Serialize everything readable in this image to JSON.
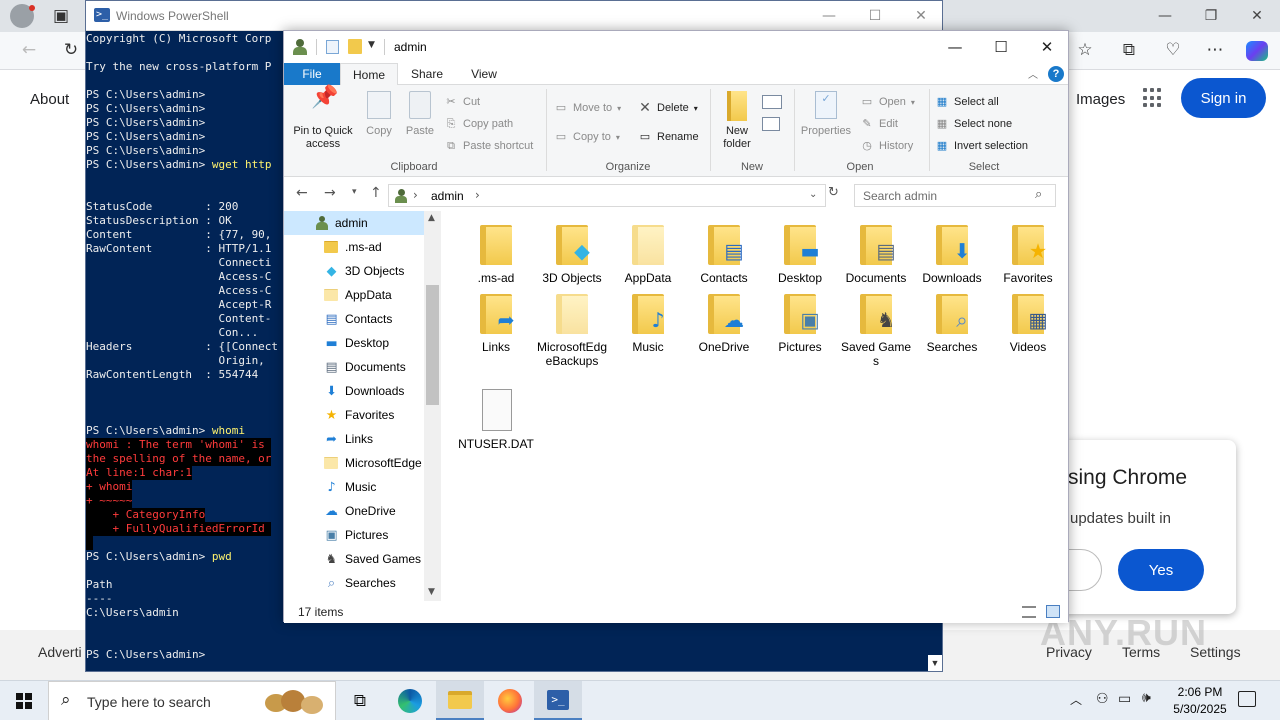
{
  "chrome": {
    "nav": {
      "about": "About",
      "images": "Images",
      "sign_in": "Sign in"
    },
    "promo": {
      "title": "sing Chrome",
      "subtitle": "updates built in",
      "yes": "Yes"
    },
    "footer": {
      "advertising": "Adverti",
      "privacy": "Privacy",
      "terms": "Terms",
      "settings": "Settings"
    },
    "watermark": "ANY.RUN"
  },
  "powershell": {
    "title": "Windows PowerShell",
    "lines": [
      {
        "t": "Copyright (C) Microsoft Corp"
      },
      {
        "t": ""
      },
      {
        "t": "Try the new cross-platform P"
      },
      {
        "t": ""
      },
      {
        "t": "PS C:\\Users\\admin>"
      },
      {
        "t": "PS C:\\Users\\admin>"
      },
      {
        "t": "PS C:\\Users\\admin>"
      },
      {
        "t": "PS C:\\Users\\admin>"
      },
      {
        "t": "PS C:\\Users\\admin>"
      },
      {
        "t": "PS C:\\Users\\admin> ",
        "cmd": "wget http"
      },
      {
        "t": ""
      },
      {
        "t": ""
      },
      {
        "t": "StatusCode        : 200"
      },
      {
        "t": "StatusDescription : OK"
      },
      {
        "t": "Content           : {77, 90,"
      },
      {
        "t": "RawContent        : HTTP/1.1"
      },
      {
        "t": "                    Connecti"
      },
      {
        "t": "                    Access-C"
      },
      {
        "t": "                    Access-C"
      },
      {
        "t": "                    Accept-R"
      },
      {
        "t": "                    Content-"
      },
      {
        "t": "                    Con..."
      },
      {
        "t": "Headers           : {[Connect"
      },
      {
        "t": "                    Origin, "
      },
      {
        "t": "RawContentLength  : 554744"
      },
      {
        "t": ""
      },
      {
        "t": ""
      },
      {
        "t": ""
      },
      {
        "t": "PS C:\\Users\\admin> ",
        "cmd": "whomi"
      },
      {
        "t": "whomi : The term 'whomi' is ",
        "err": true
      },
      {
        "t": "the spelling of the name, or",
        "err": true
      },
      {
        "t": "At line:1 char:1",
        "err": true
      },
      {
        "t": "+ whomi",
        "err": true
      },
      {
        "t": "+ ~~~~~",
        "err": true
      },
      {
        "t": "    + CategoryInfo",
        "err": true
      },
      {
        "t": "    + FullyQualifiedErrorId ",
        "err": true
      },
      {
        "t": " ",
        "err": true
      },
      {
        "t": "PS C:\\Users\\admin> ",
        "cmd": "pwd"
      },
      {
        "t": ""
      },
      {
        "t": "Path"
      },
      {
        "t": "----"
      },
      {
        "t": "C:\\Users\\admin"
      },
      {
        "t": ""
      },
      {
        "t": ""
      },
      {
        "t": "PS C:\\Users\\admin>"
      }
    ]
  },
  "explorer": {
    "title": "admin",
    "tabs": {
      "file": "File",
      "home": "Home",
      "share": "Share",
      "view": "View"
    },
    "ribbon": {
      "pin": "Pin to Quick access",
      "copy": "Copy",
      "paste": "Paste",
      "cut": "Cut",
      "copy_path": "Copy path",
      "paste_shortcut": "Paste shortcut",
      "clipboard": "Clipboard",
      "move_to": "Move to",
      "copy_to": "Copy to",
      "delete": "Delete",
      "rename": "Rename",
      "organize": "Organize",
      "new_folder": "New folder",
      "new": "New",
      "properties": "Properties",
      "open": "Open",
      "edit": "Edit",
      "history": "History",
      "open_group": "Open",
      "select_all": "Select all",
      "select_none": "Select none",
      "invert_selection": "Invert selection",
      "select": "Select"
    },
    "address": {
      "segment": "admin"
    },
    "search_placeholder": "Search admin",
    "tree": [
      {
        "label": "admin",
        "icon": "user",
        "selected": true
      },
      {
        "label": ".ms-ad",
        "icon": "folder"
      },
      {
        "label": "3D Objects",
        "icon": "cube"
      },
      {
        "label": "AppData",
        "icon": "folder-light"
      },
      {
        "label": "Contacts",
        "icon": "contacts"
      },
      {
        "label": "Desktop",
        "icon": "desktop"
      },
      {
        "label": "Documents",
        "icon": "documents"
      },
      {
        "label": "Downloads",
        "icon": "downloads"
      },
      {
        "label": "Favorites",
        "icon": "star"
      },
      {
        "label": "Links",
        "icon": "links"
      },
      {
        "label": "MicrosoftEdge",
        "icon": "folder-light"
      },
      {
        "label": "Music",
        "icon": "music"
      },
      {
        "label": "OneDrive",
        "icon": "cloud"
      },
      {
        "label": "Pictures",
        "icon": "pictures"
      },
      {
        "label": "Saved Games",
        "icon": "games"
      },
      {
        "label": "Searches",
        "icon": "search"
      }
    ],
    "items": [
      {
        "label": ".ms-ad",
        "icon": "folder"
      },
      {
        "label": "3D Objects",
        "icon": "cube"
      },
      {
        "label": "AppData",
        "icon": "folder-light"
      },
      {
        "label": "Contacts",
        "icon": "contacts"
      },
      {
        "label": "Desktop",
        "icon": "desktop"
      },
      {
        "label": "Documents",
        "icon": "documents"
      },
      {
        "label": "Downloads",
        "icon": "downloads"
      },
      {
        "label": "Favorites",
        "icon": "star"
      },
      {
        "label": "Links",
        "icon": "links"
      },
      {
        "label": "MicrosoftEdgeBackups",
        "icon": "folder-light"
      },
      {
        "label": "Music",
        "icon": "music"
      },
      {
        "label": "OneDrive",
        "icon": "cloud"
      },
      {
        "label": "Pictures",
        "icon": "pictures"
      },
      {
        "label": "Saved Games",
        "icon": "games"
      },
      {
        "label": "Searches",
        "icon": "search"
      },
      {
        "label": "Videos",
        "icon": "videos"
      },
      {
        "label": "NTUSER.DAT",
        "icon": "file"
      }
    ],
    "status": "17 items"
  },
  "taskbar": {
    "search_placeholder": "Type here to search",
    "time": "2:06 PM",
    "date": "5/30/2025"
  },
  "colors": {
    "ps_background": "#012456",
    "accent": "#0b57d0",
    "file_tab": "#1979ca",
    "folder": "#f2c94c"
  }
}
